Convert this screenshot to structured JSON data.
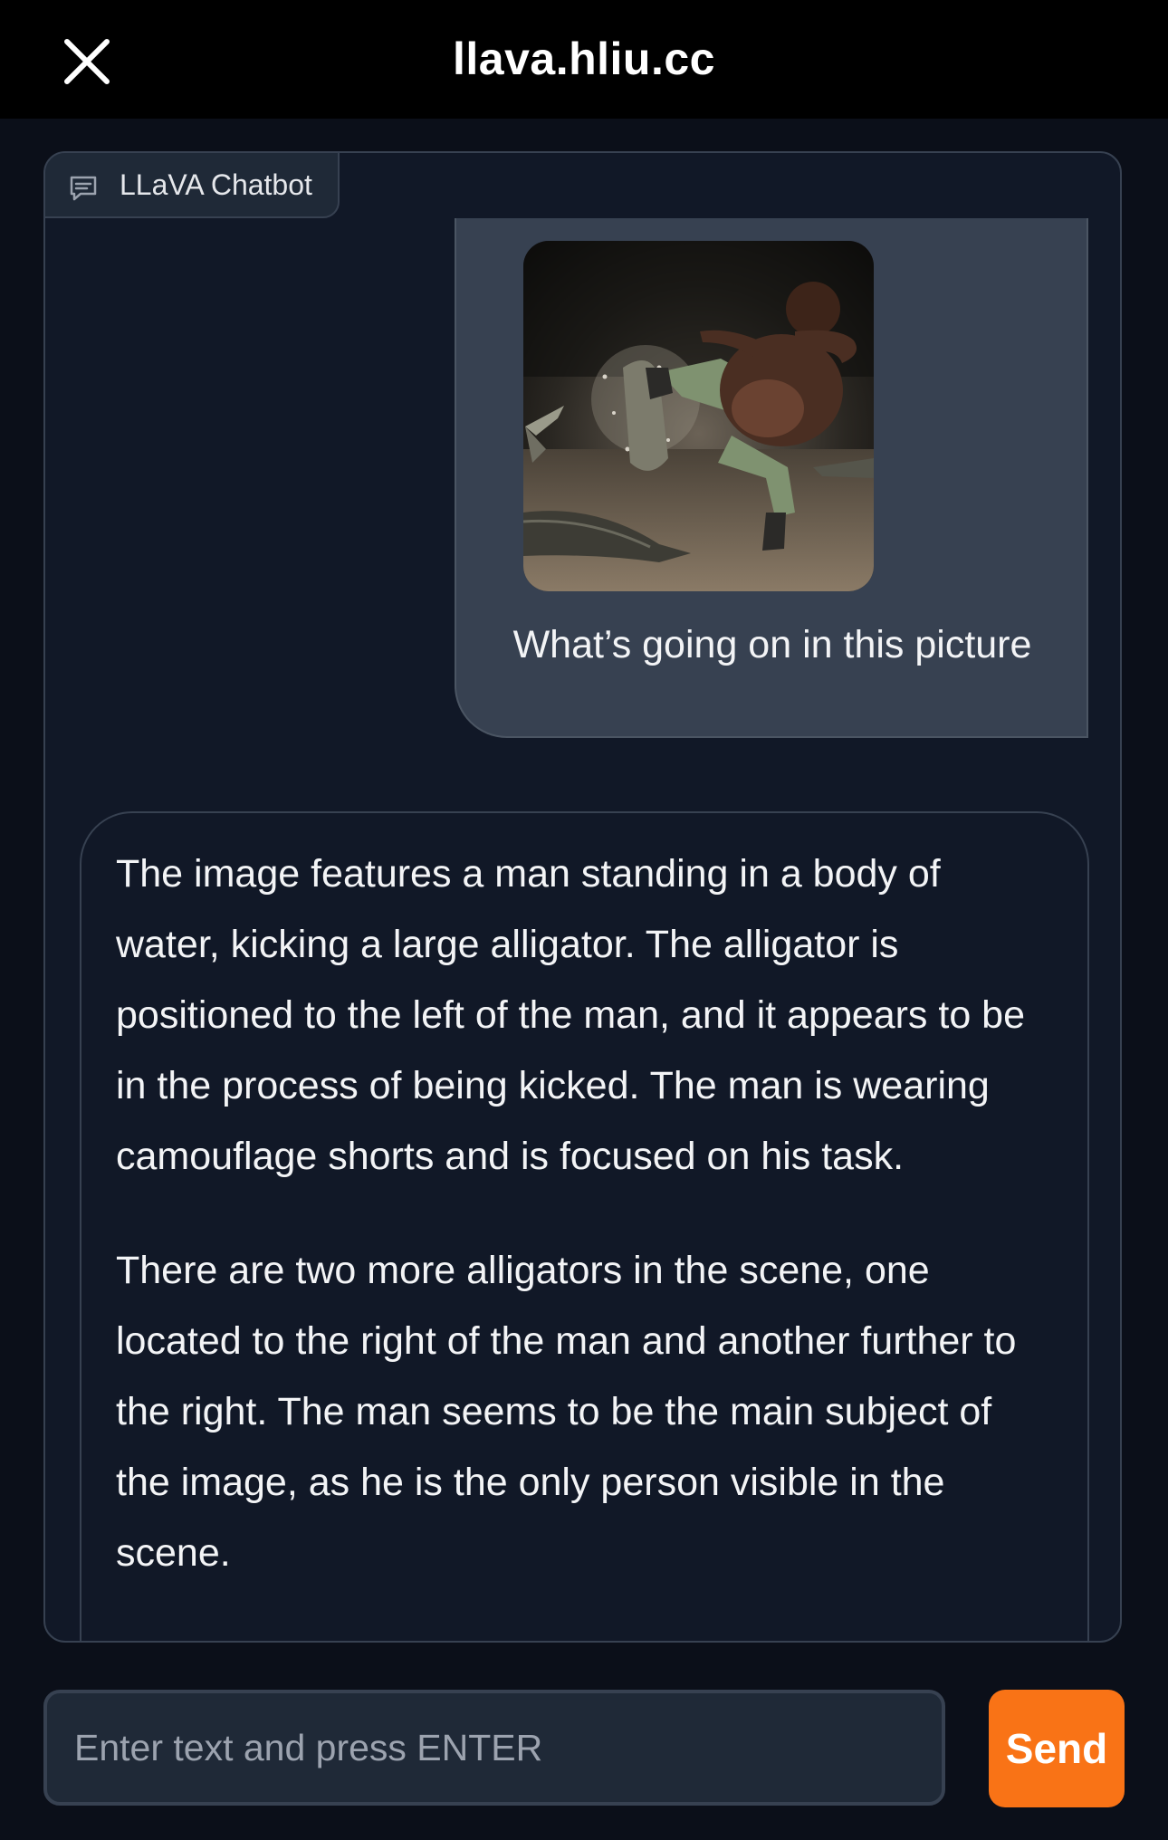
{
  "browser": {
    "site_title": "llava.hliu.cc",
    "close_icon": "close-icon"
  },
  "chatbot": {
    "label": "LLaVA Chatbot",
    "label_icon": "chat-bubble-icon"
  },
  "messages": [
    {
      "role": "user",
      "image": "photo of man kicking alligator",
      "text": "What’s going on in this picture"
    },
    {
      "role": "bot",
      "paragraphs": [
        "The image features a man standing in a body of water, kicking a large alligator. The alligator is positioned to the left of the man, and it appears to be in the process of being kicked. The man is wearing camouflage shorts and is focused on his task.",
        "There are two more alligators in the scene, one located to the right of the man and another further to the right. The man seems to be the main subject of the image, as he is the only person visible in the scene."
      ]
    }
  ],
  "input": {
    "placeholder": "Enter text and press ENTER",
    "value": ""
  },
  "send_button": {
    "label": "Send"
  },
  "colors": {
    "accent": "#f97316",
    "background": "#0b0f19",
    "panel": "#111827",
    "user_bubble": "#374151"
  }
}
